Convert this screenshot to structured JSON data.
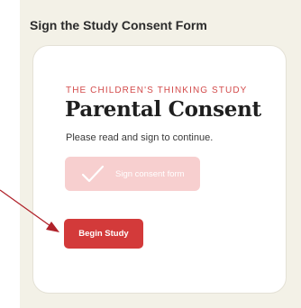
{
  "section": {
    "title": "Sign the Study Consent Form"
  },
  "card": {
    "eyebrow": "THE CHILDREN'S THINKING STUDY",
    "headline": "Parental Consent",
    "subtext": "Please read and sign to continue.",
    "consent_button": {
      "label": "Sign consent form",
      "state": "disabled"
    },
    "begin_button": {
      "label": "Begin Study"
    }
  },
  "colors": {
    "panel_background": "#f3f1e7",
    "accent_red": "#d33a3a",
    "eyebrow_red": "#d34b4b",
    "disabled_pink": "#f7cfcf",
    "annotation_arrow": "#b0222a"
  },
  "icons": {
    "consent_check": "checkmark-icon",
    "annotation": "arrow-annotation"
  }
}
